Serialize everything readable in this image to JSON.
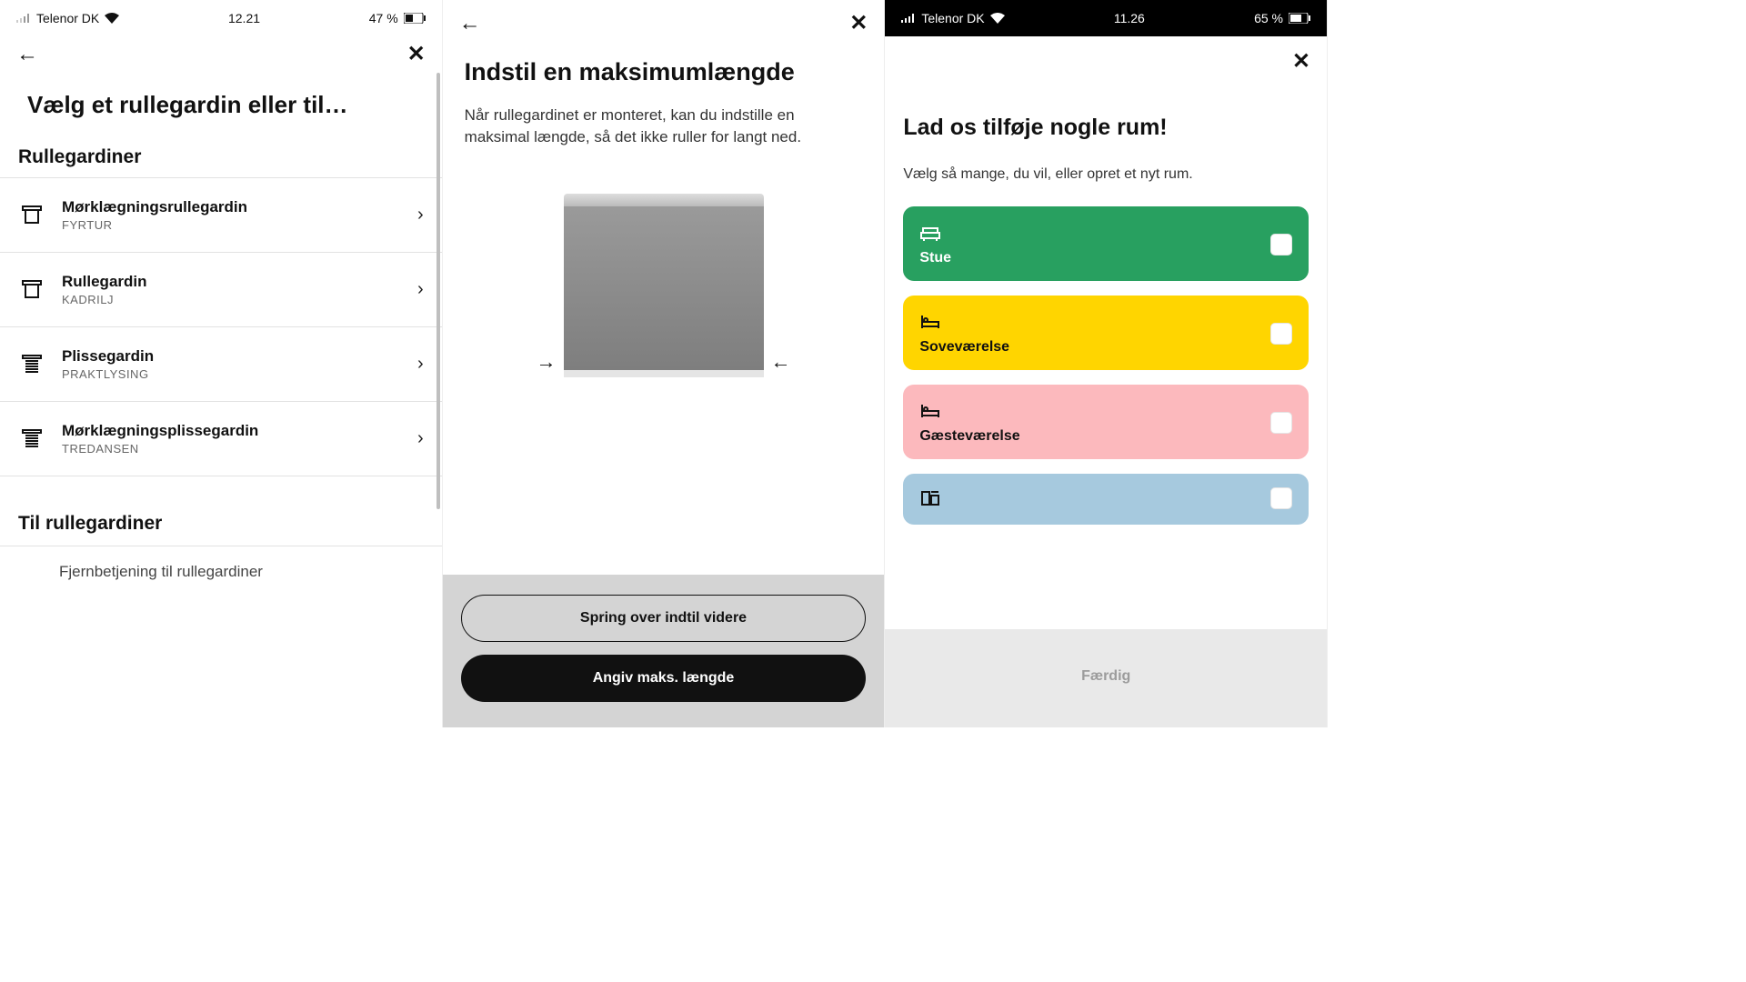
{
  "screen1": {
    "status": {
      "carrier": "Telenor DK",
      "time": "12.21",
      "battery": "47 %"
    },
    "title": "Vælg et rullegardin eller til…",
    "section1": "Rullegardiner",
    "items": [
      {
        "title": "Mørklægningsrullegardin",
        "sub": "FYRTUR",
        "icon": "blind-icon"
      },
      {
        "title": "Rullegardin",
        "sub": "KADRILJ",
        "icon": "blind-icon"
      },
      {
        "title": "Plissegardin",
        "sub": "PRAKTLYSING",
        "icon": "pleated-icon"
      },
      {
        "title": "Mørklægningsplissegardin",
        "sub": "TREDANSEN",
        "icon": "pleated-icon"
      }
    ],
    "section2": "Til rullegardiner",
    "partial_item": "Fjernbetjening til rullegardiner"
  },
  "screen2": {
    "title": "Indstil en maksimumlængde",
    "desc": "Når rullegardinet er monteret, kan du indstille en maksimal længde, så det ikke ruller for langt ned.",
    "skip_label": "Spring over indtil videre",
    "set_label": "Angiv maks. længde"
  },
  "screen3": {
    "status": {
      "carrier": "Telenor DK",
      "time": "11.26",
      "battery": "65 %"
    },
    "title": "Lad os tilføje nogle rum!",
    "sub": "Vælg så mange, du vil, eller opret et nyt rum.",
    "rooms": [
      {
        "label": "Stue",
        "color": "c-green",
        "icon": "sofa"
      },
      {
        "label": "Soveværelse",
        "color": "c-yellow",
        "icon": "bed"
      },
      {
        "label": "Gæsteværelse",
        "color": "c-pink",
        "icon": "bed"
      },
      {
        "label": "",
        "color": "c-blue",
        "icon": "kitchen"
      }
    ],
    "done_label": "Færdig"
  },
  "glyphs": {
    "back": "←",
    "close": "✕",
    "chevron": "›",
    "arrow_right": "→",
    "arrow_left": "←",
    "wifi": "◢",
    "battery_box": "▭"
  }
}
